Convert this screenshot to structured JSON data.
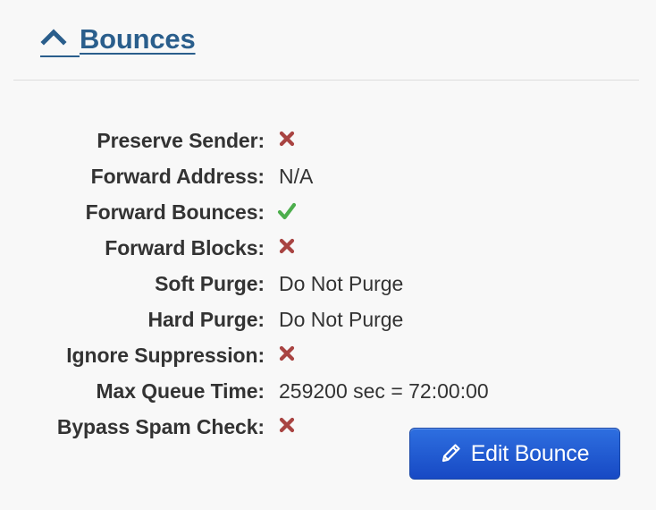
{
  "section": {
    "title": "Bounces",
    "toggle_icon": "chevron-up-icon",
    "link_color": "#2a5e8c"
  },
  "properties": [
    {
      "label": "Preserve Sender:",
      "type": "icon",
      "icon": "cross-icon"
    },
    {
      "label": "Forward Address:",
      "type": "text",
      "value": "N/A"
    },
    {
      "label": "Forward Bounces:",
      "type": "icon",
      "icon": "check-icon"
    },
    {
      "label": "Forward Blocks:",
      "type": "icon",
      "icon": "cross-icon"
    },
    {
      "label": "Soft Purge:",
      "type": "text",
      "value": "Do Not Purge"
    },
    {
      "label": "Hard Purge:",
      "type": "text",
      "value": "Do Not Purge"
    },
    {
      "label": "Ignore Suppression:",
      "type": "icon",
      "icon": "cross-icon"
    },
    {
      "label": "Max Queue Time:",
      "type": "text",
      "value": "259200 sec = 72:00:00"
    },
    {
      "label": "Bypass Spam Check:",
      "type": "icon",
      "icon": "cross-icon"
    }
  ],
  "colors": {
    "cross": "#a94442",
    "check": "#4cae4c",
    "button": "#1f5bd1"
  },
  "edit_button": {
    "label": "Edit Bounce",
    "icon": "pencil-icon"
  }
}
